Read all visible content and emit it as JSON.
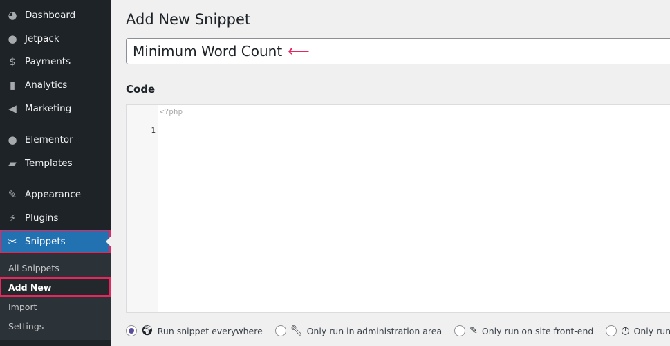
{
  "sidebar": {
    "items": [
      {
        "label": "Dashboard",
        "icon": "dashboard-icon"
      },
      {
        "label": "Jetpack",
        "icon": "jetpack-icon"
      },
      {
        "label": "Payments",
        "icon": "payments-icon"
      },
      {
        "label": "Analytics",
        "icon": "analytics-icon"
      },
      {
        "label": "Marketing",
        "icon": "megaphone-icon"
      },
      {
        "label": "Elementor",
        "icon": "elementor-icon"
      },
      {
        "label": "Templates",
        "icon": "folder-icon"
      },
      {
        "label": "Appearance",
        "icon": "paintbrush-icon"
      },
      {
        "label": "Plugins",
        "icon": "plugin-icon"
      },
      {
        "label": "Snippets",
        "icon": "scissors-icon"
      }
    ],
    "submenu": [
      {
        "label": "All Snippets"
      },
      {
        "label": "Add New"
      },
      {
        "label": "Import"
      },
      {
        "label": "Settings"
      }
    ]
  },
  "page": {
    "title": "Add New Snippet",
    "snippet_title": "Minimum Word Count",
    "code_label": "Code",
    "code_placeholder": "<?php",
    "line_number": "1"
  },
  "scope": {
    "options": [
      {
        "label": "Run snippet everywhere",
        "icon": "globe-icon",
        "selected": true
      },
      {
        "label": "Only run in administration area",
        "icon": "wrench-icon",
        "selected": false
      },
      {
        "label": "Only run on site front-end",
        "icon": "paintbrush-icon",
        "selected": false
      },
      {
        "label": "Only run once",
        "icon": "clock-icon",
        "selected": false
      }
    ]
  },
  "colors": {
    "accent": "#2271b1",
    "highlight": "#e8265e",
    "sidebar": "#1d2327"
  }
}
